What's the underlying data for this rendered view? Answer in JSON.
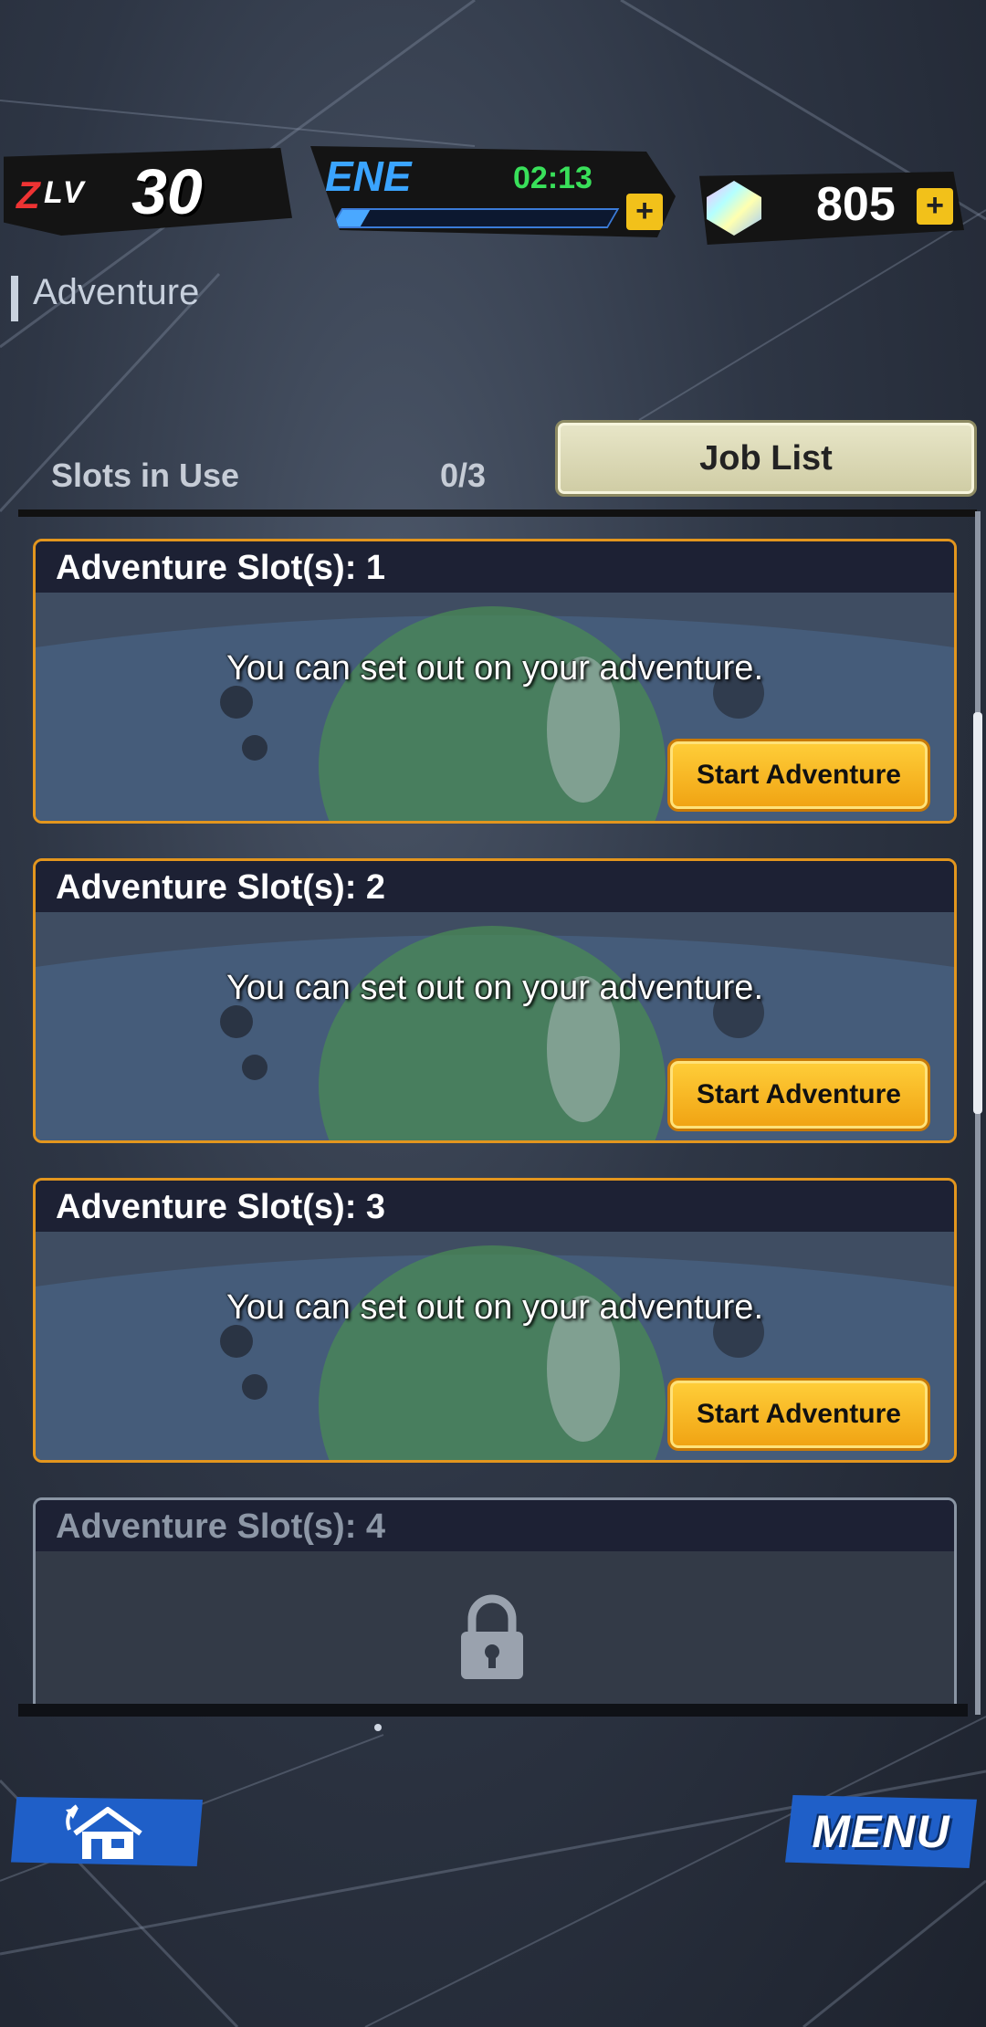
{
  "status": {
    "level_prefix": "Z",
    "level_label": "LV",
    "level_value": "30",
    "energy_label": "ENE",
    "energy_timer": "02:13",
    "energy_fill_fraction": 0.1,
    "currency_amount": "805"
  },
  "page": {
    "title": "Adventure"
  },
  "slots_summary": {
    "label": "Slots in Use",
    "value": "0/3",
    "job_list_label": "Job List"
  },
  "slots": [
    {
      "title": "Adventure Slot(s): 1",
      "message": "You can set out on your adventure.",
      "button": "Start Adventure"
    },
    {
      "title": "Adventure Slot(s): 2",
      "message": "You can set out on your adventure.",
      "button": "Start Adventure"
    },
    {
      "title": "Adventure Slot(s): 3",
      "message": "You can set out on your adventure.",
      "button": "Start Adventure"
    },
    {
      "title": "Adventure Slot(s): 4",
      "locked": true
    }
  ],
  "nav": {
    "menu_label": "MENU"
  },
  "colors": {
    "accent_orange": "#e3961e",
    "button_yellow": "#f6b42a",
    "nav_blue": "#1f5fc8",
    "energy_blue": "#3aa4ff",
    "timer_green": "#39e05a"
  }
}
